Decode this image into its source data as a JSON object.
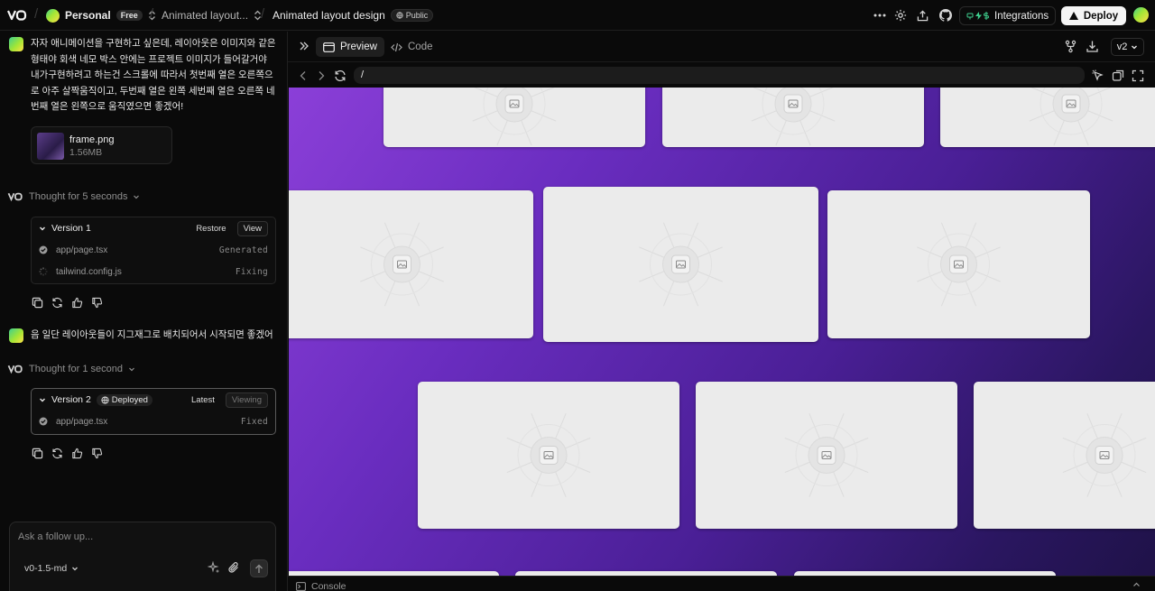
{
  "topbar": {
    "workspace": "Personal",
    "plan_badge": "Free",
    "project": "Animated layout...",
    "chat_title": "Animated layout design",
    "visibility_badge": "Public",
    "integrations_label": "Integrations",
    "deploy_label": "Deploy"
  },
  "chat": {
    "first_message": "자자 애니메이션을 구현하고 싶은데, 레이아웃은 이미지와 같은 형태야 회색 네모 박스 안에는 프로젝트 이미지가 들어갈거야 내가구현하려고 하는건 스크롤에 따라서 첫번째 열은 오른쪽으로 아주 살짝움직이고, 두번째 열은 왼쪽 세번째 열은 오른쪽 네번째 열은 왼쪽으로 움직였으면 좋겠어!",
    "attachment": {
      "name": "frame.png",
      "size": "1.56MB"
    },
    "thought_1": "Thought for 5 seconds",
    "version_1": {
      "title": "Version 1",
      "restore_label": "Restore",
      "view_label": "View",
      "files": [
        {
          "path": "app/page.tsx",
          "status": "Generated"
        },
        {
          "path": "tailwind.config.js",
          "status": "Fixing"
        }
      ]
    },
    "second_message": "음 일단 레이아웃들이 지그재그로 배치되어서 시작되면 좋겠어",
    "thought_2": "Thought for 1 second",
    "version_2": {
      "title": "Version 2",
      "deployed_label": "Deployed",
      "latest_label": "Latest",
      "viewing_label": "Viewing",
      "files": [
        {
          "path": "app/page.tsx",
          "status": "Fixed"
        }
      ]
    },
    "composer": {
      "placeholder": "Ask a follow up...",
      "model": "v0-1.5-md"
    }
  },
  "preview": {
    "tab_preview": "Preview",
    "tab_code": "Code",
    "version_select": "v2",
    "url": "/",
    "console_label": "Console",
    "background_colors": [
      "#8b3fd8",
      "#4a1f96",
      "#1f1248"
    ]
  }
}
